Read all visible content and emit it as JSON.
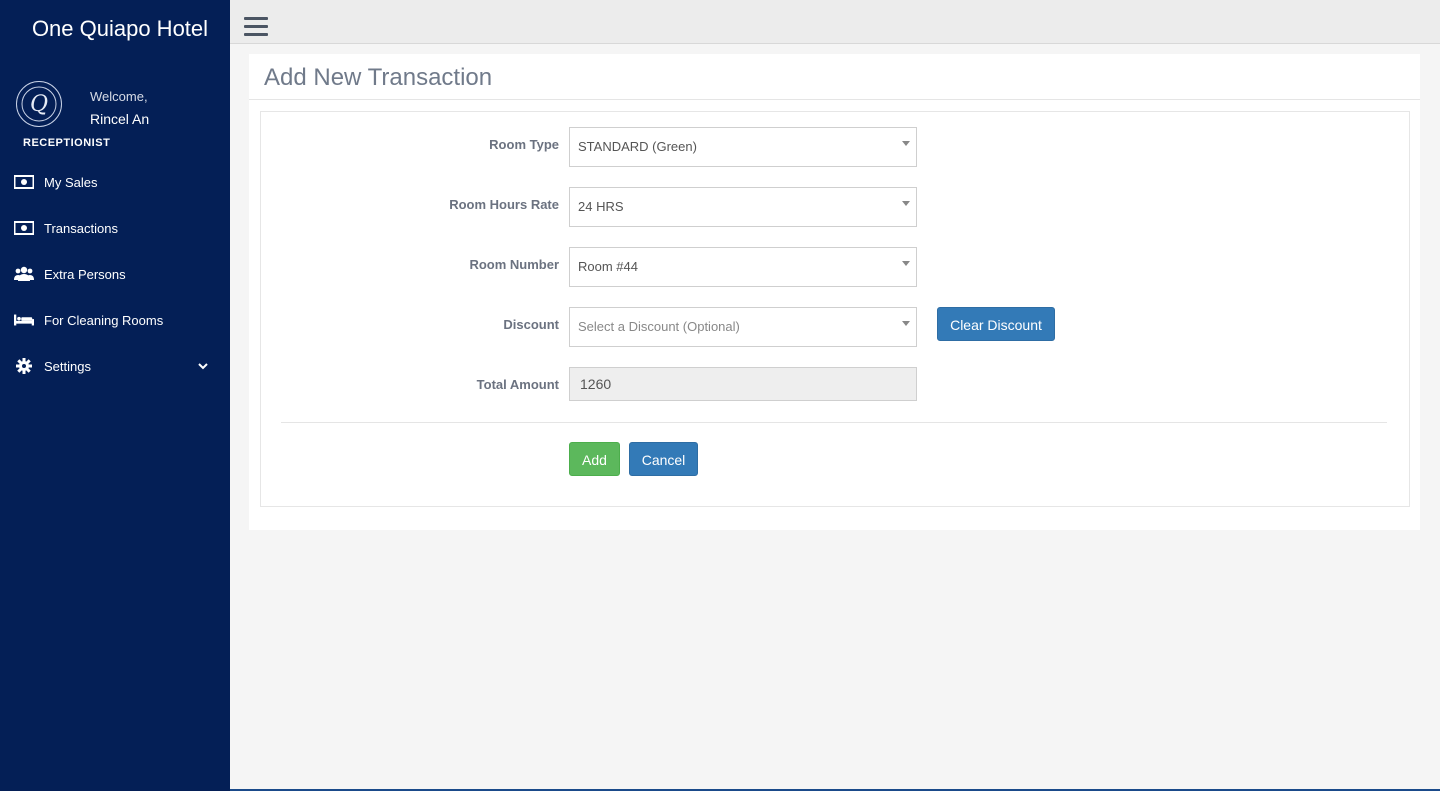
{
  "brand": {
    "title": "One Quiapo Hotel"
  },
  "user": {
    "welcome": "Welcome,",
    "name": "Rincel An",
    "role": "RECEPTIONIST"
  },
  "sidebar": {
    "items": [
      {
        "label": "My Sales",
        "icon": "money-icon"
      },
      {
        "label": "Transactions",
        "icon": "money-icon"
      },
      {
        "label": "Extra Persons",
        "icon": "users-icon"
      },
      {
        "label": "For Cleaning Rooms",
        "icon": "bed-icon"
      },
      {
        "label": "Settings",
        "icon": "gear-icon",
        "has_submenu": true
      }
    ]
  },
  "page": {
    "title": "Add New Transaction"
  },
  "form": {
    "room_type": {
      "label": "Room Type",
      "value": "STANDARD (Green)"
    },
    "room_hours_rate": {
      "label": "Room Hours Rate",
      "value": "24 HRS"
    },
    "room_number": {
      "label": "Room Number",
      "value": "Room #44"
    },
    "discount": {
      "label": "Discount",
      "placeholder": "Select a Discount (Optional)",
      "clear_label": "Clear Discount"
    },
    "total_amount": {
      "label": "Total Amount",
      "value": "1260"
    },
    "add_label": "Add",
    "cancel_label": "Cancel"
  },
  "colors": {
    "sidebar_bg": "#041f56",
    "primary": "#337ab7",
    "success": "#5cb85c"
  }
}
